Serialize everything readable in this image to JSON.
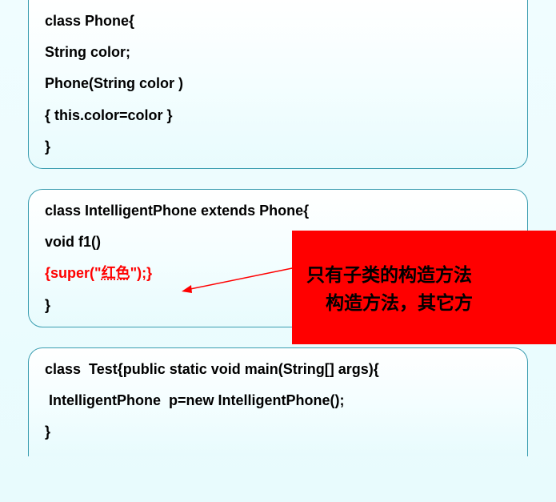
{
  "box1": {
    "l1": "class Phone{",
    "l2": "String color;",
    "l3": "Phone(String color )",
    "l4": "{ this.color=color }",
    "l5": "}"
  },
  "box2": {
    "l1": "class IntelligentPhone extends Phone{",
    "l2": "void f1()",
    "l3a": "{super(\"",
    "l3b": "红色",
    "l3c": "\");}",
    "l4": "}"
  },
  "box3": {
    "l1": "class  Test{public static void main(String[] args){",
    "l2": " IntelligentPhone  p=new IntelligentPhone();",
    "l3": "}"
  },
  "callout": {
    "line1": "只有子类的构造方法",
    "line2": "构造方法，其它方"
  }
}
